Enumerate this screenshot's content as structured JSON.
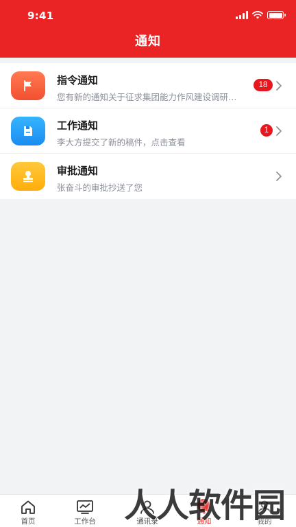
{
  "status_bar": {
    "time": "9:41"
  },
  "header": {
    "title": "通知"
  },
  "notifications": [
    {
      "title": "指令通知",
      "subtitle": "您有新的通知关于征求集团能力作风建设调研问卷的通知",
      "badge": "18",
      "icon": "flag-icon",
      "color": "#f25030"
    },
    {
      "title": "工作通知",
      "subtitle": "李大方提交了新的稿件，点击查看",
      "badge": "1",
      "icon": "document-icon",
      "color": "#1b8cf0"
    },
    {
      "title": "审批通知",
      "subtitle": "张奋斗的审批抄送了您",
      "badge": "",
      "icon": "stamp-icon",
      "color": "#ffad0c"
    }
  ],
  "tabbar": {
    "items": [
      {
        "label": "首页",
        "icon": "home-icon"
      },
      {
        "label": "工作台",
        "icon": "chart-icon"
      },
      {
        "label": "通讯录",
        "icon": "contacts-icon"
      },
      {
        "label": "通知",
        "icon": "bell-icon",
        "active": true
      },
      {
        "label": "我的",
        "icon": "user-icon"
      }
    ]
  },
  "watermark": "人人软件园",
  "colors": {
    "primary": "#ea2424",
    "badge": "#e8171d"
  }
}
